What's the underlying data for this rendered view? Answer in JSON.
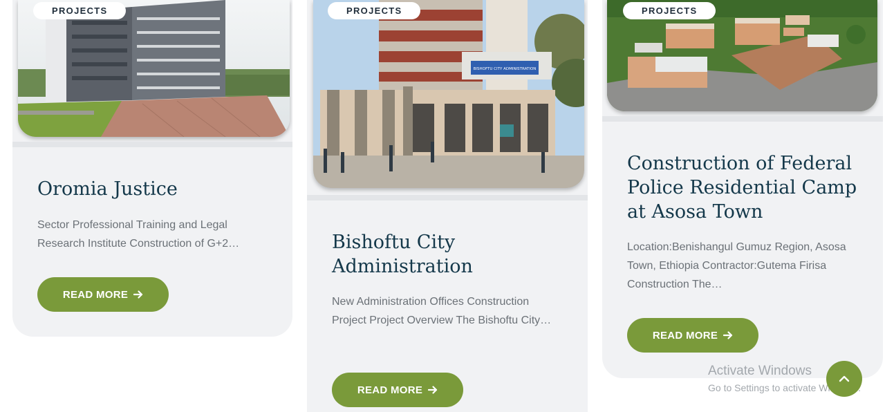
{
  "colors": {
    "accent": "#7a9a3a",
    "title": "#14384a",
    "card_bg": "#f1f2f4"
  },
  "cards": [
    {
      "badge": "PROJECTS",
      "title": "Oromia Justice",
      "excerpt": "Sector Professional Training and Legal Research Institute Construction of G+2…",
      "button": "READ MORE"
    },
    {
      "badge": "PROJECTS",
      "title": "Bishoftu City Administration",
      "excerpt": "New Administration Offices Construction Project Project Overview The Bishoftu City…",
      "button": "READ MORE",
      "building_sign": "BISHOFTU CITY ADMINISTRATION"
    },
    {
      "badge": "PROJECTS",
      "title": "Construction of Federal Police Residential Camp at Asosa Town",
      "excerpt": "Location:Benishangul Gumuz Region, Asosa Town, Ethiopia Contractor:Gutema Firisa Construction The…",
      "button": "READ MORE"
    }
  ],
  "watermark": {
    "line1": "Activate Windows",
    "line2": "Go to Settings to activate Windows."
  },
  "icons": {
    "arrow": "arrow-right-icon",
    "scroll_top": "chevron-up-icon"
  }
}
